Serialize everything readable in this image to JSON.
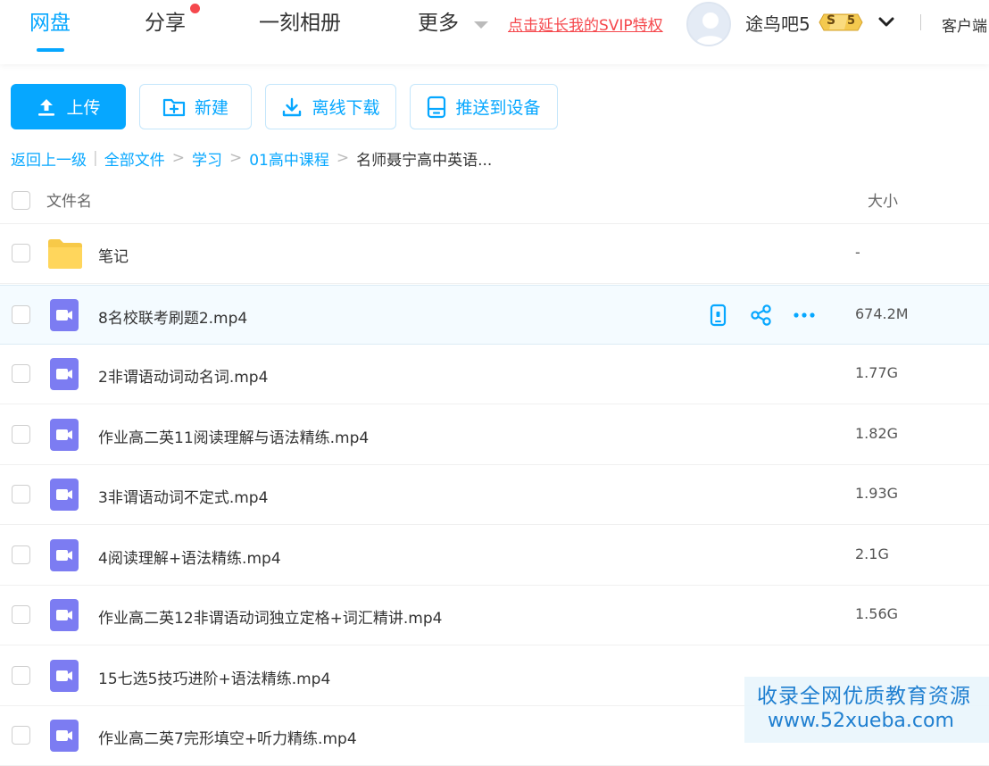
{
  "nav": {
    "tabs": [
      {
        "label": "网盘",
        "active": true
      },
      {
        "label": "分享",
        "has_dot": true
      },
      {
        "label": "一刻相册"
      },
      {
        "label": "更多"
      }
    ],
    "svip_link": "点击延长我的SVIP特权",
    "username": "途鸟吧5",
    "vip_badge": {
      "letter": "S",
      "level": "5"
    },
    "client_link": "客户端"
  },
  "toolbar": {
    "upload_label": "上传",
    "new_label": "新建",
    "offline_label": "离线下载",
    "push_label": "推送到设备"
  },
  "breadcrumb": {
    "back": "返回上一级",
    "sep": "|",
    "items": [
      "全部文件",
      "学习",
      "01高中课程"
    ],
    "current": "名师聂宁高中英语...",
    "arrow": ">"
  },
  "list": {
    "header_name": "文件名",
    "header_size": "大小",
    "rows": [
      {
        "type": "folder",
        "name": "笔记",
        "size": "-"
      },
      {
        "type": "video",
        "name": "8名校联考刷题2.mp4",
        "size": "674.2M",
        "hover": true
      },
      {
        "type": "video",
        "name": "2非谓语动词动名词.mp4",
        "size": "1.77G"
      },
      {
        "type": "video",
        "name": "作业高二英11阅读理解与语法精练.mp4",
        "size": "1.82G"
      },
      {
        "type": "video",
        "name": "3非谓语动词不定式.mp4",
        "size": "1.93G"
      },
      {
        "type": "video",
        "name": "4阅读理解+语法精练.mp4",
        "size": "2.1G"
      },
      {
        "type": "video",
        "name": "作业高二英12非谓语动词独立定格+词汇精讲.mp4",
        "size": "1.56G"
      },
      {
        "type": "video",
        "name": "15七选5技巧进阶+语法精练.mp4",
        "size": ""
      },
      {
        "type": "video",
        "name": "作业高二英7完形填空+听力精练.mp4",
        "size": ""
      }
    ]
  },
  "watermark": {
    "line1": "收录全网优质教育资源",
    "line2": "www.52xueba.com"
  },
  "colors": {
    "accent": "#06a7ff",
    "alert": "#f5484d",
    "folder": "#ffd65c",
    "video": "#7c7cf2"
  }
}
